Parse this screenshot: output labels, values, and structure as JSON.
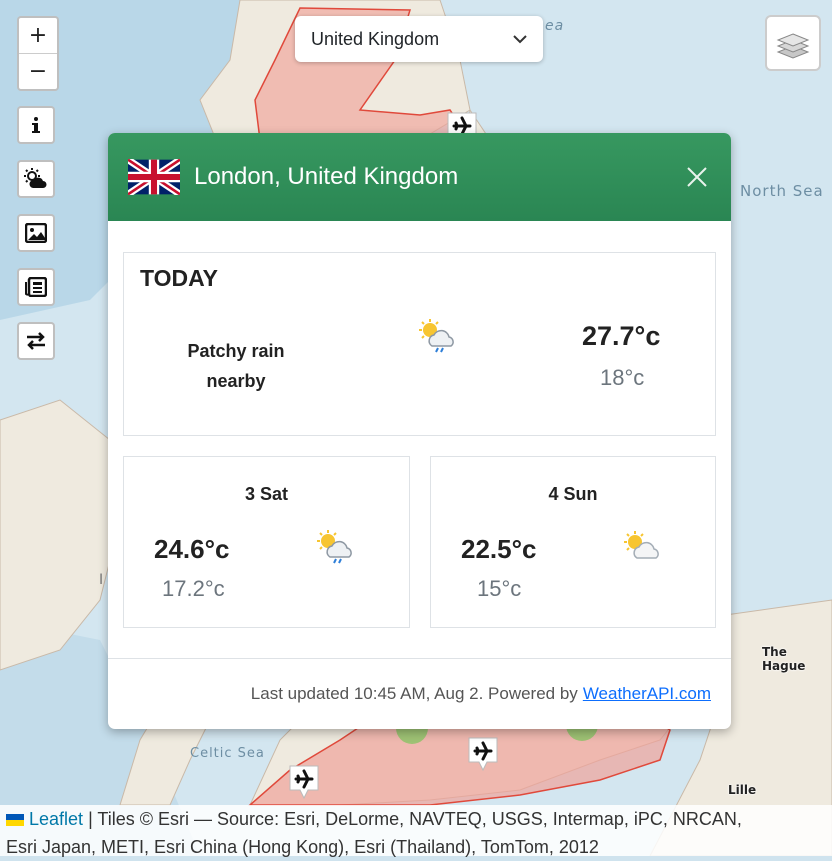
{
  "map": {
    "labels": {
      "north_sea": "North Sea",
      "the_hague": "The Hague",
      "celtic_sea": "Celtic Sea",
      "lille": "Lille",
      "sea_fragment": "ea",
      "map_fragment": "I"
    },
    "zoom_in": "+",
    "zoom_out": "−",
    "controls": [
      "info-icon",
      "weather-icon",
      "image-icon",
      "news-icon",
      "swap-icon"
    ],
    "cluster_count": "2"
  },
  "country_select": {
    "value": "United Kingdom"
  },
  "modal": {
    "title": "London, United Kingdom",
    "today": {
      "label": "TODAY",
      "condition": "Patchy rain nearby",
      "max": "27.7°c",
      "min": "18°c"
    },
    "forecast": [
      {
        "day": "3 Sat",
        "max": "24.6°c",
        "min": "17.2°c"
      },
      {
        "day": "4 Sun",
        "max": "22.5°c",
        "min": "15°c"
      }
    ],
    "footer": {
      "text": "Last updated 10:45 AM, Aug 2. Powered by",
      "link": "WeatherAPI.com"
    }
  },
  "attribution": {
    "link": "Leaflet",
    "line1": "| Tiles © Esri — Source: Esri, DeLorme, NAVTEQ, USGS, Intermap, iPC, NRCAN,",
    "line2": "Esri Japan, METI, Esri China (Hong Kong), Esri (Thailand), TomTom, 2012"
  },
  "colors": {
    "header_green": "#2e8b57",
    "highlight_red": "#f08a80",
    "link_blue": "#0d6efd"
  }
}
